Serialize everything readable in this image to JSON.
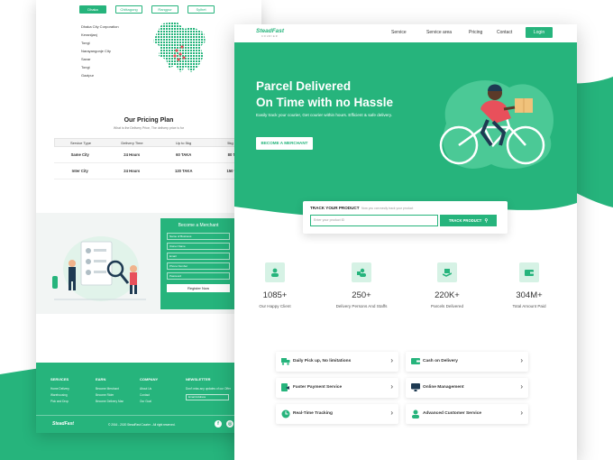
{
  "back_page": {
    "city_tabs": [
      "Dhaka",
      "Chittagong",
      "Rangpur",
      "Sylhet"
    ],
    "areas": [
      "Dhaka City Corporation",
      "Keranijanj",
      "Tongi",
      "Narayangonje City",
      "Savar",
      "Tongi",
      "Gazipur"
    ],
    "pricing": {
      "title": "Our Pricing Plan",
      "subtitle": "What is the Delivery Price, The delivery price is for",
      "headers": [
        "Service Type",
        "Delivery Time",
        "Up to 5kg",
        "5kg - 2kg"
      ],
      "rows": [
        [
          "Same City",
          "24 Hours",
          "60 TAKA",
          "80 TAKA"
        ],
        [
          "Inter City",
          "24 Hours",
          "120 TAKA",
          "150 TAKA"
        ]
      ]
    },
    "merchant_form": {
      "title": "Become a Merchant",
      "fields": [
        "Name of Business",
        "Owner Name",
        "Email",
        "Phone Number",
        "Password"
      ],
      "button": "Register Now"
    },
    "footer": {
      "columns": [
        {
          "title": "SERVICES",
          "items": [
            "Home Delivery",
            "Warehousing",
            "Pick and Drop"
          ]
        },
        {
          "title": "EARN",
          "items": [
            "Become Merchant",
            "Become Rider",
            "Become Delivery Man"
          ]
        },
        {
          "title": "COMPANY",
          "items": [
            "About Us",
            "Contact",
            "Our Goal"
          ]
        }
      ],
      "newsletter_title": "NEWSLETTER",
      "newsletter_text": "Don't miss any updates of our Offer",
      "newsletter_placeholder": "Email Address",
      "logo": "SteadFast",
      "copyright": "© 2016 - 2020 SteadFast Courier - All right reserved."
    }
  },
  "front_page": {
    "logo": "SteadFast",
    "logo_tag": "COURIER",
    "nav": [
      "Service",
      "Service area",
      "Pricing",
      "Contact"
    ],
    "login": "Login",
    "hero": {
      "title_line1": "Parcel Delivered",
      "title_line2": "On Time with no Hassle",
      "subtitle": "Easily track your courier, Get courier within hours. Efficient & safe delivery.",
      "cta": "BECOME A MERCHANT"
    },
    "track": {
      "title": "TRACK YOUR PRODUCT",
      "hint": "Now you can easily track your product",
      "placeholder": "Enter your product ID",
      "button": "TRACK PRODUCT"
    },
    "stats": [
      {
        "value": "1085+",
        "label": "Our Happy Client",
        "icon": "client-icon"
      },
      {
        "value": "250+",
        "label": "Delivery Persons And Staffs",
        "icon": "staff-icon"
      },
      {
        "value": "220K+",
        "label": "Parcels Delivered",
        "icon": "parcel-icon"
      },
      {
        "value": "304M+",
        "label": "Total Amount Paid",
        "icon": "wallet-icon"
      }
    ],
    "services": [
      {
        "label": "Daily Pick up, No limitations",
        "icon": "truck-icon"
      },
      {
        "label": "Cash on Delivery",
        "icon": "cash-icon"
      },
      {
        "label": "Faster Payment Service",
        "icon": "payment-icon"
      },
      {
        "label": "Online Management",
        "icon": "monitor-icon"
      },
      {
        "label": "Real-Time Tracking",
        "icon": "clock-icon"
      },
      {
        "label": "Advanced Customer Service",
        "icon": "support-icon"
      }
    ]
  },
  "colors": {
    "brand_green": "#26b47c",
    "light_green": "#d6f2e5",
    "dark_accent": "#1e3a52",
    "rider_red": "#e8505b"
  }
}
